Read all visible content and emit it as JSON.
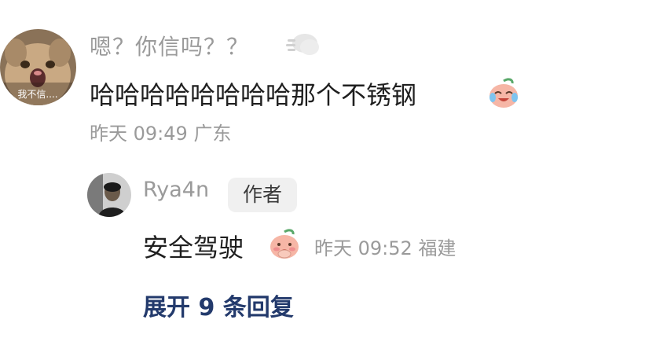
{
  "comment": {
    "avatar_icon": "cat-avatar-icon",
    "avatar_caption": "我不信....",
    "username": "嗯？你信吗？？",
    "username_icon": "speech-bubble-icon",
    "text": "哈哈哈哈哈哈哈哈那个不锈钢",
    "emoji": "crying-laughing-peach-emoji",
    "time": "昨天 09:49",
    "location": "广东"
  },
  "reply": {
    "avatar_icon": "user-photo-avatar",
    "username": "Rya4n",
    "badge": "作者",
    "text": "安全驾驶",
    "emoji": "shy-peach-emoji",
    "time": "昨天 09:52",
    "location": "福建"
  },
  "expand": {
    "label": "展开 9 条回复"
  },
  "colors": {
    "text_primary": "#1f1f1f",
    "text_secondary": "#9a9a9a",
    "link": "#233a6c",
    "badge_bg": "#f0f0f0"
  }
}
